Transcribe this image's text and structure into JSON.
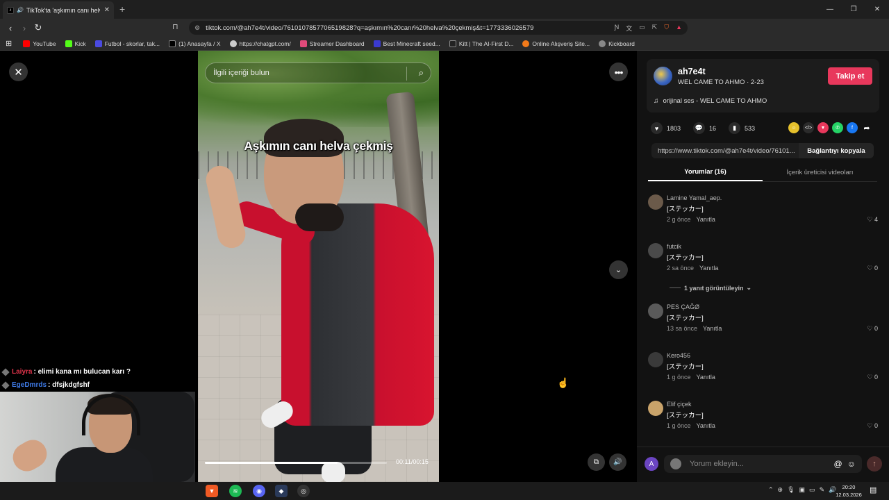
{
  "browser": {
    "tab_title": "TikTok'ta 'aşkımın canı helva ç",
    "new_tab": "+",
    "window_controls": [
      "—",
      "❐",
      "✕"
    ],
    "url": "tiktok.com/@ah7e4t/video/7610107857706519828?q=aşkımın%20canı%20helva%20çekmiş&t=1773336026579",
    "bookmarks": [
      {
        "label": "YouTube",
        "color": "#ff0000"
      },
      {
        "label": "Kick",
        "color": "#53fc18"
      },
      {
        "label": "Futbol - skorlar, tak...",
        "color": "#4a4ae0"
      },
      {
        "label": "(1) Anasayfa / X",
        "color": "#000000"
      },
      {
        "label": "https://chatgpt.com/",
        "color": "#cccccc"
      },
      {
        "label": "Streamer Dashboard",
        "color": "#e04a7a"
      },
      {
        "label": "Best Minecraft seed...",
        "color": "#3a3ad0"
      },
      {
        "label": "Kitt | The AI-First D...",
        "color": "#222222"
      },
      {
        "label": "Online Alışveriş Site...",
        "color": "#f27a1a"
      },
      {
        "label": "Kickboard",
        "color": "#888888"
      }
    ]
  },
  "video": {
    "search_placeholder": "İlgili içeriği bulun",
    "caption": "Aşkımın canı helva çekmiş",
    "time": "00:11/00:15",
    "progress": 0.73
  },
  "chat": [
    {
      "user": "Laiyra",
      "message": ": elimi kana mı bulucan karı ?",
      "color": "#e0344b"
    },
    {
      "user": "EgeDmrds",
      "message": ": dfsjkdgfshf",
      "color": "#3f7be8"
    }
  ],
  "author": {
    "handle": "ah7e4t",
    "subtitle": "WEL CAME TO AHMO · 2-23",
    "follow_label": "Takip et",
    "music": "orijinal ses - WEL CAME TO AHMO"
  },
  "stats": {
    "likes": "1803",
    "comments": "16",
    "saves": "533"
  },
  "share": {
    "link": "https://www.tiktok.com/@ah7e4t/video/76101...",
    "copy_label": "Bağlantıyı kopyala"
  },
  "tabs": {
    "comments": "Yorumlar (16)",
    "creator_videos": "İçerik üreticisi videoları"
  },
  "comments": [
    {
      "user": "Lamine Yamal_aep.",
      "text": "[ステッカー]",
      "time": "2 g önce",
      "reply": "Yanıtla",
      "likes": "4",
      "avatar": "#6b5a4a"
    },
    {
      "user": "futcik",
      "text": "[ステッカー]",
      "time": "2 sa önce",
      "reply": "Yanıtla",
      "likes": "0",
      "avatar": "#4a4a4a"
    },
    {
      "user": "PES ÇAĞØ",
      "text": "[ステッカー]",
      "time": "13 sa önce",
      "reply": "Yanıtla",
      "likes": "0",
      "avatar": "#5a5a5a"
    },
    {
      "user": "Kero456",
      "text": "[ステッカー]",
      "time": "1 g önce",
      "reply": "Yanıtla",
      "likes": "0",
      "avatar": "#3a3a3a"
    },
    {
      "user": "Elif çiçek",
      "text": "[ステッカー]",
      "time": "1 g önce",
      "reply": "Yanıtla",
      "likes": "0",
      "avatar": "#c9a36a"
    }
  ],
  "replies_link": "1 yanıt görüntüleyin",
  "comment_input": {
    "placeholder": "Yorum ekleyin...",
    "avatar_letter": "A"
  },
  "taskbar": {
    "time": "20:20",
    "date": "12.03.2026"
  }
}
